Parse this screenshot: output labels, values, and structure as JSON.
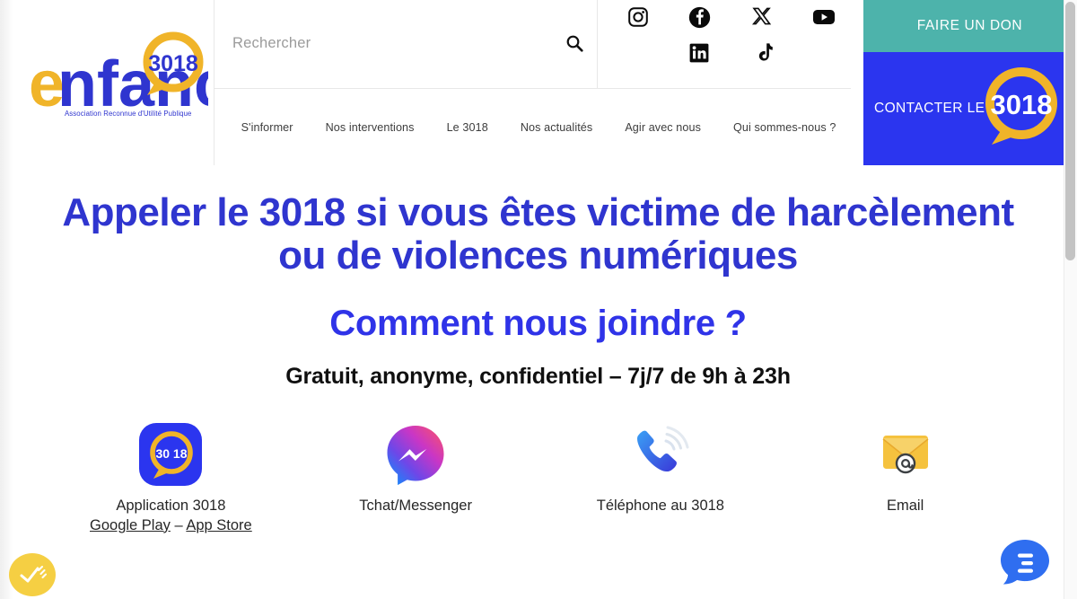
{
  "site": {
    "logo": {
      "brand_prefix": "e",
      "brand_word": "nfance",
      "bubble_number": "3018",
      "tagline": "Association Reconnue d'Utilité Publique"
    }
  },
  "header": {
    "search": {
      "placeholder": "Rechercher",
      "value": "",
      "icon": "search-icon"
    },
    "socials": [
      {
        "name": "instagram-icon",
        "label": "Instagram"
      },
      {
        "name": "facebook-icon",
        "label": "Facebook"
      },
      {
        "name": "x-twitter-icon",
        "label": "X"
      },
      {
        "name": "youtube-icon",
        "label": "YouTube"
      },
      {
        "name": "linkedin-icon",
        "label": "LinkedIn"
      },
      {
        "name": "tiktok-icon",
        "label": "TikTok"
      }
    ],
    "nav": [
      {
        "label": "S'informer"
      },
      {
        "label": "Nos interventions"
      },
      {
        "label": "Le 3018"
      },
      {
        "label": "Nos actualités"
      },
      {
        "label": "Agir avec nous"
      },
      {
        "label": "Qui sommes-nous ?"
      }
    ],
    "cta_donate": {
      "label": "FAIRE UN DON",
      "bg": "#4db3ab"
    },
    "cta_contact": {
      "label": "CONTACTER LE",
      "number": "3018",
      "bg": "#2b35ef"
    }
  },
  "main": {
    "headline": "Appeler le 3018 si vous êtes victime de harcèlement ou de violences numériques",
    "subheadline": "Comment nous joindre ?",
    "tagline": "Gratuit, anonyme, confidentiel – 7j/7 de 9h à 23h",
    "contact_options": [
      {
        "icon": "app-3018-icon",
        "label": "Application 3018",
        "links": [
          {
            "label": "Google Play"
          },
          {
            "label": "App Store"
          }
        ],
        "separator": " – "
      },
      {
        "icon": "messenger-icon",
        "label": "Tchat/Messenger",
        "links": []
      },
      {
        "icon": "phone-ringing-icon",
        "label": "Téléphone au 3018",
        "links": []
      },
      {
        "icon": "email-envelope-icon",
        "label": "Email",
        "links": []
      }
    ]
  },
  "widgets": {
    "accessibility": {
      "name": "accessibility-badge-icon",
      "color": "#f5cf43"
    },
    "chat": {
      "name": "chat-bubble-icon",
      "color": "#2f6ef0"
    }
  },
  "colors": {
    "heading_blue": "#2f35cf",
    "sub_blue": "#2f33e8",
    "brand_blue": "#2b35ef",
    "brand_teal": "#4db3ab",
    "brand_yellow": "#f0b429"
  },
  "scrollbar": {
    "position_pct": 0
  }
}
